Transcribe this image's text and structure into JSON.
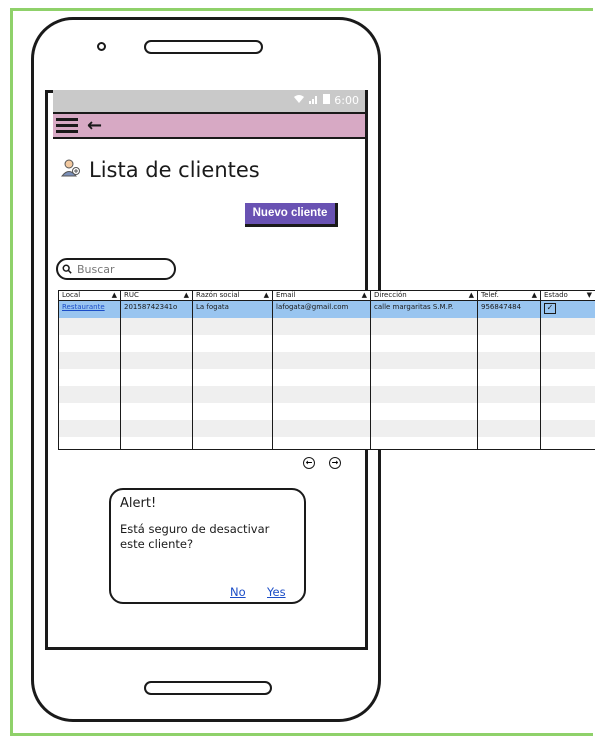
{
  "status_bar": {
    "time": "6:00"
  },
  "page": {
    "title": "Lista de clientes"
  },
  "toolbar": {
    "new_client_label": "Nuevo cliente"
  },
  "search": {
    "placeholder": "Buscar"
  },
  "table": {
    "columns": [
      "Local",
      "RUC",
      "Razón social",
      "Email",
      "Dirección",
      "Telef.",
      "Estado"
    ],
    "rows": [
      [
        "Restaurante",
        "20158742341o",
        "La fogata",
        "lafogata@gmail.com",
        "calle margaritas S.M.P.",
        "956847484",
        "checked"
      ]
    ]
  },
  "alert": {
    "title": "Alert!",
    "message": "Está seguro de desactivar este cliente?",
    "no_label": "No",
    "yes_label": "Yes"
  },
  "colors": {
    "accent": "#6952b3",
    "appbar": "#d7a9c4",
    "selected_row": "#99c5f0",
    "frame": "#8fd16a"
  }
}
